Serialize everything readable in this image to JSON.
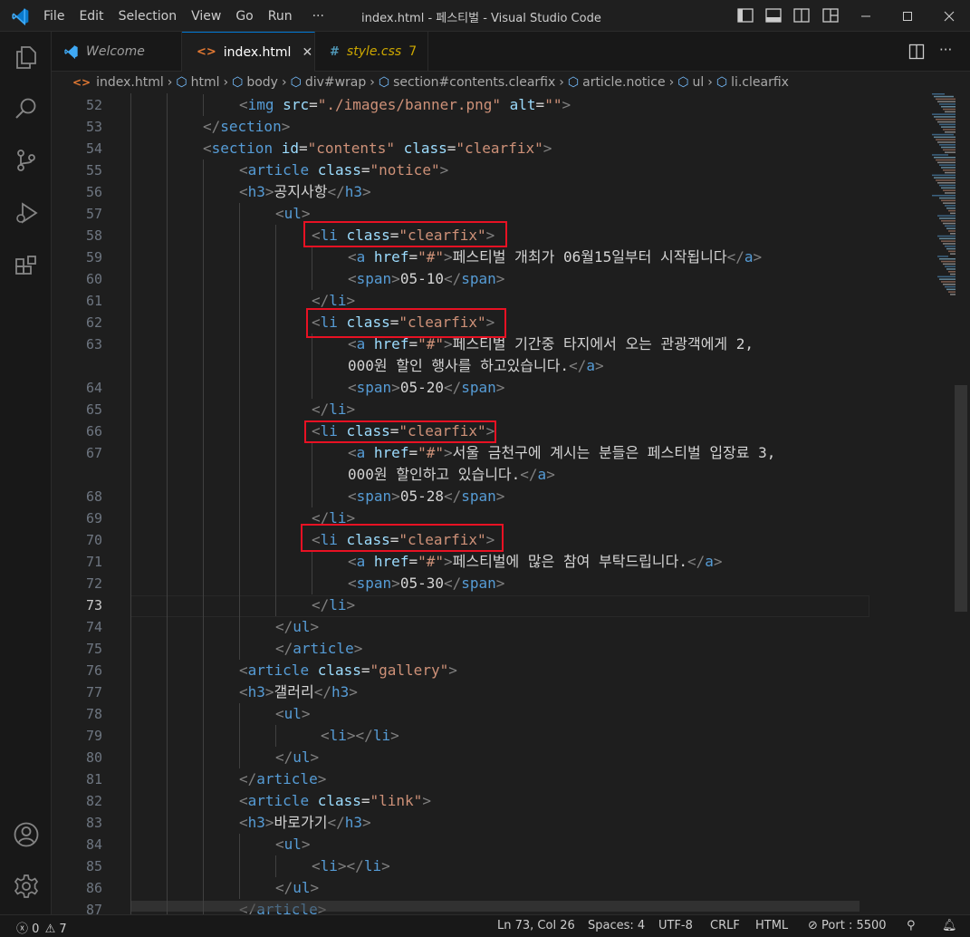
{
  "titlebar": {
    "menus": [
      "File",
      "Edit",
      "Selection",
      "View",
      "Go",
      "Run",
      "···"
    ],
    "title": "index.html - 페스티벌 - Visual Studio Code"
  },
  "tabs": [
    {
      "label": "Welcome",
      "icon": "vscode-logo-icon",
      "active": false
    },
    {
      "label": "index.html",
      "icon": "html-file-icon",
      "active": true,
      "close": "✕"
    },
    {
      "label": "style.css",
      "icon": "css-file-icon",
      "active": false,
      "badge": "7"
    }
  ],
  "breadcrumbs": [
    "index.html",
    "html",
    "body",
    "div#wrap",
    "section#contents.clearfix",
    "article.notice",
    "ul",
    "li.clearfix"
  ],
  "editor": {
    "line_numbers": [
      "52",
      "53",
      "54",
      "55",
      "56",
      "57",
      "58",
      "59",
      "60",
      "61",
      "62",
      "63",
      "",
      "64",
      "65",
      "66",
      "67",
      "",
      "68",
      "69",
      "70",
      "71",
      "72",
      "73",
      "74",
      "75",
      "76",
      "77",
      "78",
      "79",
      "80",
      "81",
      "82",
      "83",
      "84",
      "85",
      "86",
      "87"
    ],
    "current_line": "73",
    "code": [
      {
        "ind": 3,
        "s": [
          [
            "pu",
            "<"
          ],
          [
            "tg",
            "img"
          ],
          [
            "at",
            " src"
          ],
          [
            "tx",
            "="
          ],
          [
            "st",
            "\"./images/banner.png\""
          ],
          [
            "at",
            " alt"
          ],
          [
            "tx",
            "="
          ],
          [
            "st",
            "\"\""
          ],
          [
            "pu",
            ">"
          ]
        ]
      },
      {
        "ind": 2,
        "s": [
          [
            "pu",
            "</"
          ],
          [
            "tg",
            "section"
          ],
          [
            "pu",
            ">"
          ]
        ]
      },
      {
        "ind": 2,
        "s": [
          [
            "pu",
            "<"
          ],
          [
            "tg",
            "section"
          ],
          [
            "at",
            " id"
          ],
          [
            "tx",
            "="
          ],
          [
            "st",
            "\"contents\""
          ],
          [
            "at",
            " class"
          ],
          [
            "tx",
            "="
          ],
          [
            "st",
            "\"clearfix\""
          ],
          [
            "pu",
            ">"
          ]
        ]
      },
      {
        "ind": 3,
        "s": [
          [
            "pu",
            "<"
          ],
          [
            "tg",
            "article"
          ],
          [
            "at",
            " class"
          ],
          [
            "tx",
            "="
          ],
          [
            "st",
            "\"notice\""
          ],
          [
            "pu",
            ">"
          ]
        ]
      },
      {
        "ind": 3,
        "s": [
          [
            "pu",
            "<"
          ],
          [
            "tg",
            "h3"
          ],
          [
            "pu",
            ">"
          ],
          [
            "tx",
            "공지사항"
          ],
          [
            "pu",
            "</"
          ],
          [
            "tg",
            "h3"
          ],
          [
            "pu",
            ">"
          ]
        ]
      },
      {
        "ind": 4,
        "s": [
          [
            "pu",
            "<"
          ],
          [
            "tg",
            "ul"
          ],
          [
            "pu",
            ">"
          ]
        ]
      },
      {
        "ind": 5,
        "s": [
          [
            "pu",
            "<"
          ],
          [
            "tg",
            "li"
          ],
          [
            "at",
            " class"
          ],
          [
            "tx",
            "="
          ],
          [
            "st",
            "\"clearfix\""
          ],
          [
            "pu",
            ">"
          ]
        ]
      },
      {
        "ind": 6,
        "s": [
          [
            "pu",
            "<"
          ],
          [
            "tg",
            "a"
          ],
          [
            "at",
            " href"
          ],
          [
            "tx",
            "="
          ],
          [
            "st",
            "\"#\""
          ],
          [
            "pu",
            ">"
          ],
          [
            "tx",
            "페스티벌 개최가 06월15일부터 시작됩니다"
          ],
          [
            "pu",
            "</"
          ],
          [
            "tg",
            "a"
          ],
          [
            "pu",
            ">"
          ]
        ]
      },
      {
        "ind": 6,
        "s": [
          [
            "pu",
            "<"
          ],
          [
            "tg",
            "span"
          ],
          [
            "pu",
            ">"
          ],
          [
            "tx",
            "05-10"
          ],
          [
            "pu",
            "</"
          ],
          [
            "tg",
            "span"
          ],
          [
            "pu",
            ">"
          ]
        ]
      },
      {
        "ind": 5,
        "s": [
          [
            "pu",
            "</"
          ],
          [
            "tg",
            "li"
          ],
          [
            "pu",
            ">"
          ]
        ]
      },
      {
        "ind": 5,
        "s": [
          [
            "pu",
            "<"
          ],
          [
            "tg",
            "li"
          ],
          [
            "at",
            " class"
          ],
          [
            "tx",
            "="
          ],
          [
            "st",
            "\"clearfix\""
          ],
          [
            "pu",
            ">"
          ]
        ]
      },
      {
        "ind": 6,
        "s": [
          [
            "pu",
            "<"
          ],
          [
            "tg",
            "a"
          ],
          [
            "at",
            " href"
          ],
          [
            "tx",
            "="
          ],
          [
            "st",
            "\"#\""
          ],
          [
            "pu",
            ">"
          ],
          [
            "tx",
            "페스티벌 기간중 타지에서 오는 관광객에게 2,"
          ]
        ]
      },
      {
        "ind": 6,
        "s": [
          [
            "tx",
            "000원 할인 행사를 하고있습니다."
          ],
          [
            "pu",
            "</"
          ],
          [
            "tg",
            "a"
          ],
          [
            "pu",
            ">"
          ]
        ]
      },
      {
        "ind": 6,
        "s": [
          [
            "pu",
            "<"
          ],
          [
            "tg",
            "span"
          ],
          [
            "pu",
            ">"
          ],
          [
            "tx",
            "05-20"
          ],
          [
            "pu",
            "</"
          ],
          [
            "tg",
            "span"
          ],
          [
            "pu",
            ">"
          ]
        ]
      },
      {
        "ind": 5,
        "s": [
          [
            "pu",
            "</"
          ],
          [
            "tg",
            "li"
          ],
          [
            "pu",
            ">"
          ]
        ]
      },
      {
        "ind": 5,
        "s": [
          [
            "pu",
            "<"
          ],
          [
            "tg",
            "li"
          ],
          [
            "at",
            " class"
          ],
          [
            "tx",
            "="
          ],
          [
            "st",
            "\"clearfix\""
          ],
          [
            "pu",
            ">"
          ]
        ]
      },
      {
        "ind": 6,
        "s": [
          [
            "pu",
            "<"
          ],
          [
            "tg",
            "a"
          ],
          [
            "at",
            " href"
          ],
          [
            "tx",
            "="
          ],
          [
            "st",
            "\"#\""
          ],
          [
            "pu",
            ">"
          ],
          [
            "tx",
            "서울 금천구에 계시는 분들은 페스티벌 입장료 3,"
          ]
        ]
      },
      {
        "ind": 6,
        "s": [
          [
            "tx",
            "000원 할인하고 있습니다."
          ],
          [
            "pu",
            "</"
          ],
          [
            "tg",
            "a"
          ],
          [
            "pu",
            ">"
          ]
        ]
      },
      {
        "ind": 6,
        "s": [
          [
            "pu",
            "<"
          ],
          [
            "tg",
            "span"
          ],
          [
            "pu",
            ">"
          ],
          [
            "tx",
            "05-28"
          ],
          [
            "pu",
            "</"
          ],
          [
            "tg",
            "span"
          ],
          [
            "pu",
            ">"
          ]
        ]
      },
      {
        "ind": 5,
        "s": [
          [
            "pu",
            "</"
          ],
          [
            "tg",
            "li"
          ],
          [
            "pu",
            ">"
          ]
        ]
      },
      {
        "ind": 5,
        "s": [
          [
            "pu",
            "<"
          ],
          [
            "tg",
            "li"
          ],
          [
            "at",
            " class"
          ],
          [
            "tx",
            "="
          ],
          [
            "st",
            "\"clearfix\""
          ],
          [
            "pu",
            ">"
          ]
        ]
      },
      {
        "ind": 6,
        "s": [
          [
            "pu",
            "<"
          ],
          [
            "tg",
            "a"
          ],
          [
            "at",
            " href"
          ],
          [
            "tx",
            "="
          ],
          [
            "st",
            "\"#\""
          ],
          [
            "pu",
            ">"
          ],
          [
            "tx",
            "페스티벌에 많은 참여 부탁드립니다."
          ],
          [
            "pu",
            "</"
          ],
          [
            "tg",
            "a"
          ],
          [
            "pu",
            ">"
          ]
        ]
      },
      {
        "ind": 6,
        "s": [
          [
            "pu",
            "<"
          ],
          [
            "tg",
            "span"
          ],
          [
            "pu",
            ">"
          ],
          [
            "tx",
            "05-30"
          ],
          [
            "pu",
            "</"
          ],
          [
            "tg",
            "span"
          ],
          [
            "pu",
            ">"
          ]
        ]
      },
      {
        "ind": 5,
        "s": [
          [
            "pu",
            "</"
          ],
          [
            "tg",
            "li"
          ],
          [
            "pu",
            ">"
          ]
        ]
      },
      {
        "ind": 4,
        "s": [
          [
            "pu",
            "</"
          ],
          [
            "tg",
            "ul"
          ],
          [
            "pu",
            ">"
          ]
        ]
      },
      {
        "ind": 4,
        "s": [
          [
            "pu",
            "</"
          ],
          [
            "tg",
            "article"
          ],
          [
            "pu",
            ">"
          ]
        ]
      },
      {
        "ind": 3,
        "s": [
          [
            "pu",
            "<"
          ],
          [
            "tg",
            "article"
          ],
          [
            "at",
            " class"
          ],
          [
            "tx",
            "="
          ],
          [
            "st",
            "\"gallery\""
          ],
          [
            "pu",
            ">"
          ]
        ]
      },
      {
        "ind": 3,
        "s": [
          [
            "pu",
            "<"
          ],
          [
            "tg",
            "h3"
          ],
          [
            "pu",
            ">"
          ],
          [
            "tx",
            "갤러리"
          ],
          [
            "pu",
            "</"
          ],
          [
            "tg",
            "h3"
          ],
          [
            "pu",
            ">"
          ]
        ]
      },
      {
        "ind": 4,
        "s": [
          [
            "pu",
            "<"
          ],
          [
            "tg",
            "ul"
          ],
          [
            "pu",
            ">"
          ]
        ]
      },
      {
        "ind": 5.25,
        "s": [
          [
            "pu",
            "<"
          ],
          [
            "tg",
            "li"
          ],
          [
            "pu",
            "></"
          ],
          [
            "tg",
            "li"
          ],
          [
            "pu",
            ">"
          ]
        ]
      },
      {
        "ind": 4,
        "s": [
          [
            "pu",
            "</"
          ],
          [
            "tg",
            "ul"
          ],
          [
            "pu",
            ">"
          ]
        ]
      },
      {
        "ind": 3,
        "s": [
          [
            "pu",
            "</"
          ],
          [
            "tg",
            "article"
          ],
          [
            "pu",
            ">"
          ]
        ]
      },
      {
        "ind": 3,
        "s": [
          [
            "pu",
            "<"
          ],
          [
            "tg",
            "article"
          ],
          [
            "at",
            " class"
          ],
          [
            "tx",
            "="
          ],
          [
            "st",
            "\"link\""
          ],
          [
            "pu",
            ">"
          ]
        ]
      },
      {
        "ind": 3,
        "s": [
          [
            "pu",
            "<"
          ],
          [
            "tg",
            "h3"
          ],
          [
            "pu",
            ">"
          ],
          [
            "tx",
            "바로가기"
          ],
          [
            "pu",
            "</"
          ],
          [
            "tg",
            "h3"
          ],
          [
            "pu",
            ">"
          ]
        ]
      },
      {
        "ind": 4,
        "s": [
          [
            "pu",
            "<"
          ],
          [
            "tg",
            "ul"
          ],
          [
            "pu",
            ">"
          ]
        ]
      },
      {
        "ind": 5,
        "s": [
          [
            "pu",
            "<"
          ],
          [
            "tg",
            "li"
          ],
          [
            "pu",
            "></"
          ],
          [
            "tg",
            "li"
          ],
          [
            "pu",
            ">"
          ]
        ]
      },
      {
        "ind": 4,
        "s": [
          [
            "pu",
            "</"
          ],
          [
            "tg",
            "ul"
          ],
          [
            "pu",
            ">"
          ]
        ]
      },
      {
        "ind": 3,
        "s": [
          [
            "pu",
            "</"
          ],
          [
            "tg",
            "article"
          ],
          [
            "pu",
            ">"
          ]
        ]
      }
    ]
  },
  "statusbar": {
    "errors": "0",
    "warnings": "7",
    "position": "Ln 73, Col 26",
    "spaces": "Spaces: 4",
    "encoding": "UTF-8",
    "eol": "CRLF",
    "language": "HTML",
    "port": "Port : 5500"
  },
  "colors": {
    "tag": "#569cd6",
    "attr": "#9cdcfe",
    "string": "#ce9178",
    "accent": "#0078d4",
    "highlight": "#e81123"
  }
}
